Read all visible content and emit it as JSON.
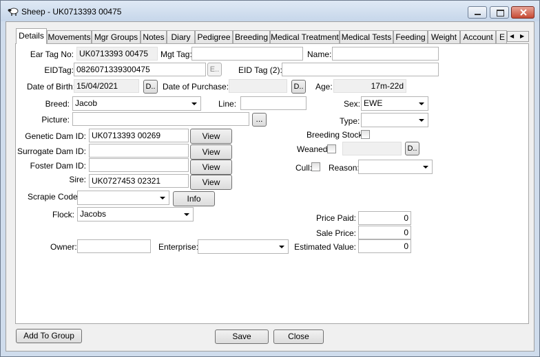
{
  "window": {
    "title": "Sheep - UK0713393 00475"
  },
  "tabs": [
    "Details",
    "Movements",
    "Mgr Groups",
    "Notes",
    "Diary",
    "Pedigree",
    "Breeding",
    "Medical Treatment",
    "Medical Tests",
    "Feeding",
    "Weight",
    "Account",
    "E"
  ],
  "active_tab": "Details",
  "tab_scroll": {
    "left": "◀",
    "right": "▶"
  },
  "form": {
    "ear_tag_label": "Ear Tag No:",
    "ear_tag_value": "UK0713393 00475",
    "mgt_tag_label": "Mgt Tag:",
    "mgt_tag_value": "",
    "name_label": "Name:",
    "name_value": "",
    "eid_tag_label": "EIDTag:",
    "eid_tag_value": "0826071339300475",
    "eid_btn": "E..",
    "eid_tag2_label": "EID Tag (2):",
    "eid_tag2_value": "",
    "dob_label": "Date of Birth:",
    "dob_value": "15/04/2021",
    "dob_btn": "D..",
    "dop_label": "Date of Purchase:",
    "dop_value": "",
    "dop_btn": "D..",
    "age_label": "Age:",
    "age_value": "17m-22d",
    "breed_label": "Breed:",
    "breed_value": "Jacob",
    "line_label": "Line:",
    "line_value": "",
    "sex_label": "Sex:",
    "sex_value": "EWE",
    "picture_label": "Picture:",
    "picture_value": "",
    "picture_btn": "...",
    "type_label": "Type:",
    "type_value": "",
    "genetic_dam_label": "Genetic Dam ID:",
    "genetic_dam_value": "UK0713393 00269",
    "surrogate_dam_label": "Surrogate Dam ID:",
    "surrogate_dam_value": "",
    "foster_dam_label": "Foster Dam ID:",
    "foster_dam_value": "",
    "sire_label": "Sire:",
    "sire_value": "UK0727453 02321",
    "view_btn": "View",
    "breeding_stock_label": "Breeding Stock:",
    "weaned_label": "Weaned",
    "weaned_value": "",
    "weaned_btn": "D..",
    "cull_label": "Cull:",
    "reason_label": "Reason:",
    "reason_value": "",
    "scrapie_label": "Scrapie Code:",
    "scrapie_value": "",
    "info_btn": "Info",
    "flock_label": "Flock:",
    "flock_value": "Jacobs",
    "price_paid_label": "Price Paid:",
    "price_paid_value": "0",
    "sale_price_label": "Sale Price:",
    "sale_price_value": "0",
    "owner_label": "Owner:",
    "owner_value": "",
    "enterprise_label": "Enterprise:",
    "enterprise_value": "",
    "estimated_value_label": "Estimated Value:",
    "estimated_value_value": "0"
  },
  "footer": {
    "add_to_group": "Add To Group",
    "save": "Save",
    "close": "Close"
  }
}
